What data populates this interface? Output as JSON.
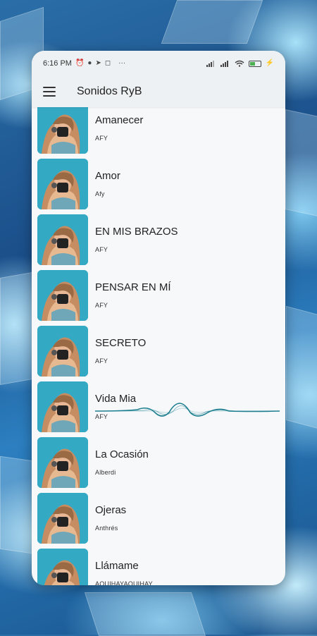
{
  "status_bar": {
    "time": "6:16 PM",
    "left_icons": [
      "alarm-icon",
      "chat-icon",
      "telegram-icon",
      "instagram-icon",
      "more-icon"
    ],
    "right_icons": [
      "signal-icon",
      "signal-icon",
      "wifi-icon",
      "battery-icon"
    ],
    "battery_level": 0.55
  },
  "app_bar": {
    "title": "Sonidos RyB",
    "menu_icon": "menu-icon"
  },
  "songs": [
    {
      "title": "Amanecer",
      "artist": "AFY",
      "playing": false
    },
    {
      "title": "Amor",
      "artist": "Afy",
      "playing": false
    },
    {
      "title": "EN MIS BRAZOS",
      "artist": "AFY",
      "playing": false
    },
    {
      "title": "PENSAR EN MÍ",
      "artist": "AFY",
      "playing": false
    },
    {
      "title": "SECRETO",
      "artist": "AFY",
      "playing": false
    },
    {
      "title": "Vida Mia",
      "artist": "AFY",
      "playing": true
    },
    {
      "title": "La Ocasión",
      "artist": "Alberdi",
      "playing": false
    },
    {
      "title": "Ojeras",
      "artist": "Anthrés",
      "playing": false
    },
    {
      "title": "Llámame",
      "artist": "AQUIHAYAQUIHAY",
      "playing": false
    }
  ],
  "colors": {
    "accent": "#1e8a9c",
    "wave": "#1d7f8f",
    "battery": "#4caf50"
  }
}
